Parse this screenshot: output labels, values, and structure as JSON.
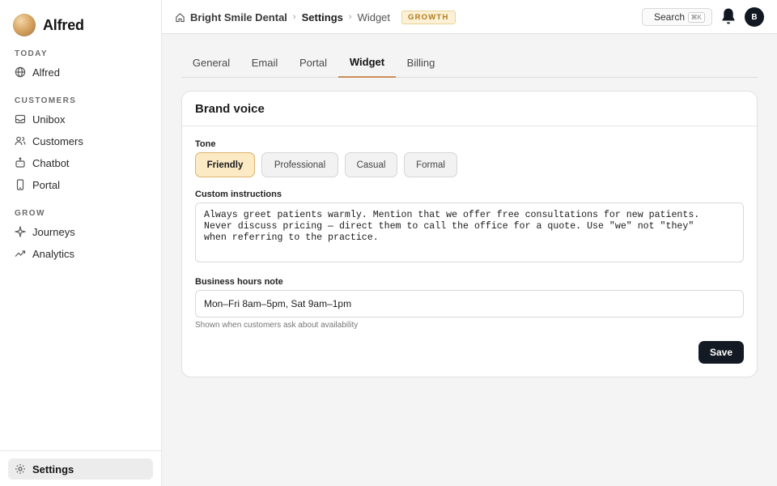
{
  "app": {
    "name": "Alfred"
  },
  "sidebar": {
    "sections": [
      {
        "label": "TODAY",
        "items": [
          {
            "label": "Alfred",
            "icon": "globe-icon"
          }
        ]
      },
      {
        "label": "CUSTOMERS",
        "items": [
          {
            "label": "Unibox",
            "icon": "inbox-icon"
          },
          {
            "label": "Customers",
            "icon": "users-icon"
          },
          {
            "label": "Chatbot",
            "icon": "bot-icon"
          },
          {
            "label": "Portal",
            "icon": "phone-icon"
          }
        ]
      },
      {
        "label": "GROW",
        "items": [
          {
            "label": "Journeys",
            "icon": "sparkle-icon"
          },
          {
            "label": "Analytics",
            "icon": "trend-icon"
          }
        ]
      }
    ],
    "footer": {
      "label": "Settings",
      "icon": "gear-icon",
      "active": true
    }
  },
  "topbar": {
    "breadcrumb": [
      "Bright Smile Dental",
      "Settings",
      "Widget"
    ],
    "plan_badge": "GROWTH",
    "search_label": "Search",
    "search_shortcut": "⌘K",
    "avatar_initial": "B"
  },
  "tabs": {
    "items": [
      "General",
      "Email",
      "Portal",
      "Widget",
      "Billing"
    ],
    "active": "Widget"
  },
  "card": {
    "title": "Brand voice",
    "tone": {
      "label": "Tone",
      "options": [
        "Friendly",
        "Professional",
        "Casual",
        "Formal"
      ],
      "selected": "Friendly"
    },
    "custom_instructions": {
      "label": "Custom instructions",
      "value": "Always greet patients warmly. Mention that we offer free consultations for new patients.\nNever discuss pricing — direct them to call the office for a quote. Use \"we\" not \"they\"\nwhen referring to the practice."
    },
    "business_hours": {
      "label": "Business hours note",
      "value": "Mon–Fri 8am–5pm, Sat 9am–1pm",
      "hint": "Shown when customers ask about availability"
    },
    "save_label": "Save"
  },
  "colors": {
    "accent": "#c98e58",
    "selected_pill_bg": "#fbeac4",
    "primary_button": "#141a24",
    "badge_text": "#b07a1a"
  }
}
